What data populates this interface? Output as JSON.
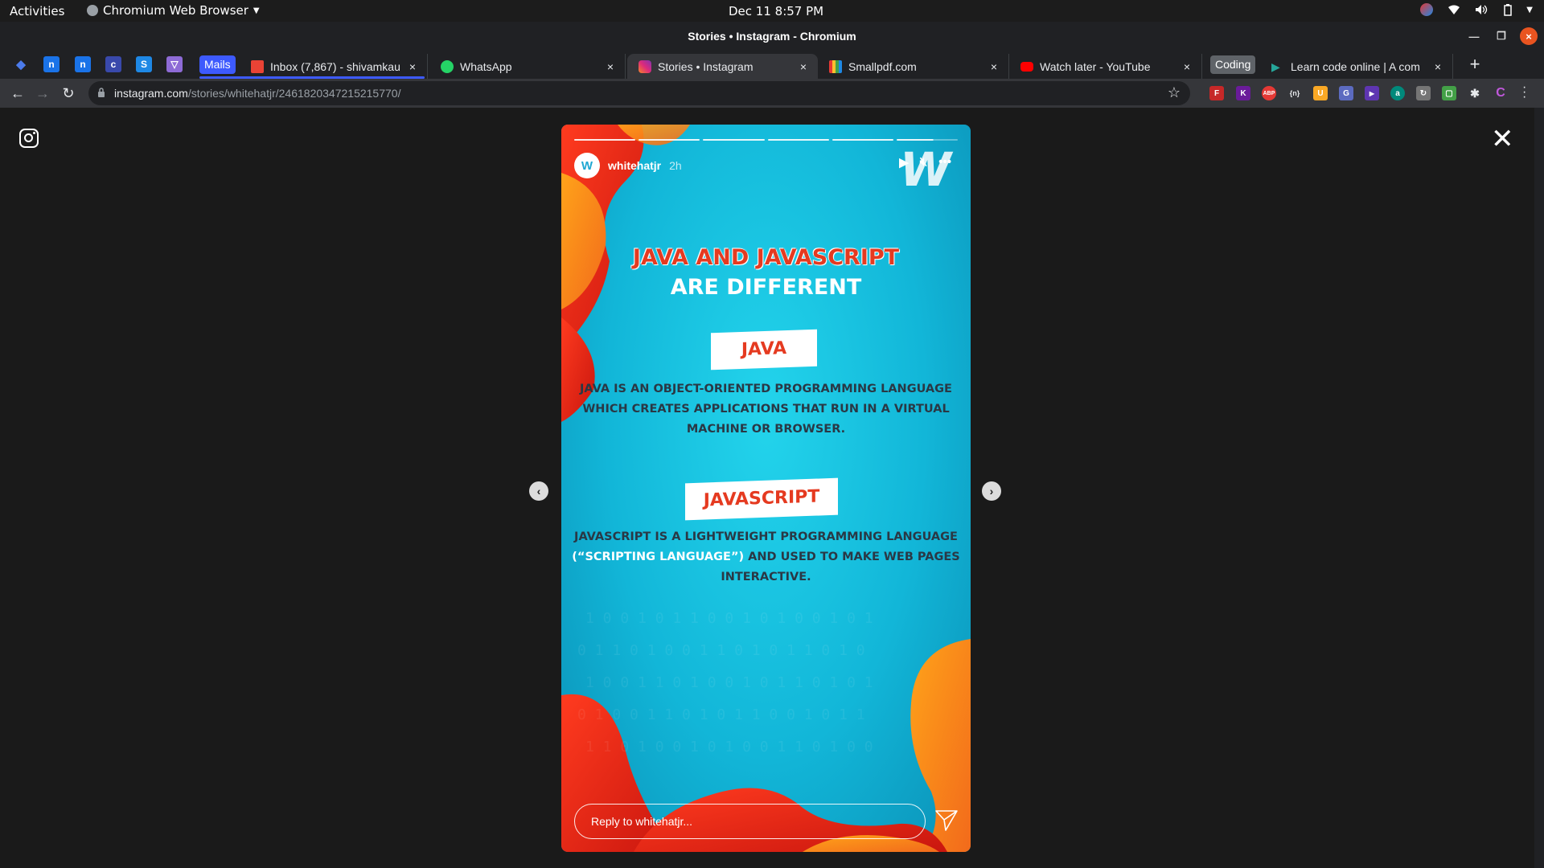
{
  "system_bar": {
    "activities": "Activities",
    "app_name": "Chromium Web Browser",
    "clock": "Dec 11   8:57 PM"
  },
  "window": {
    "title": "Stories • Instagram - Chromium"
  },
  "pinned_tabs": [
    {
      "glyph": "◆",
      "color": "#1a73e8",
      "bg": "transparent"
    },
    {
      "glyph": "n",
      "color": "#fff",
      "bg": "#1a73e8"
    },
    {
      "glyph": "n",
      "color": "#fff",
      "bg": "#1a73e8"
    },
    {
      "glyph": "c",
      "color": "#fff",
      "bg": "#3949ab"
    },
    {
      "glyph": "S",
      "color": "#fff",
      "bg": "#1e88e5"
    },
    {
      "glyph": "▽",
      "color": "#fff",
      "bg": "#8e6bd6"
    }
  ],
  "tab_groups": {
    "mails": {
      "label": "Mails",
      "color": "#3d5afe"
    },
    "coding": {
      "label": "Coding",
      "color": "#5f6368"
    }
  },
  "tabs": [
    {
      "label": "Inbox (7,867) - shivamkau",
      "favicon_color": "#ea4335"
    },
    {
      "label": "WhatsApp",
      "favicon_color": "#25d366"
    },
    {
      "label": "Stories • Instagram",
      "favicon_color": "#e1306c"
    },
    {
      "label": "Smallpdf.com",
      "favicon_color": "#e53935"
    },
    {
      "label": "Watch later - YouTube",
      "favicon_color": "#ff0000"
    },
    {
      "label": "Learn code online | A com",
      "favicon_color": "#26a69a"
    }
  ],
  "tab_close": "×",
  "address_bar": {
    "host": "instagram.com",
    "path": "/stories/whitehatjr/2461820347215215770/"
  },
  "extensions": [
    {
      "glyph": "F",
      "color": "#c62828"
    },
    {
      "glyph": "K",
      "color": "#6a1b9a"
    },
    {
      "glyph": "ABP",
      "color": "#e53935"
    },
    {
      "glyph": "{n}",
      "color": "#5f6368"
    },
    {
      "glyph": "U",
      "color": "#f9a825"
    },
    {
      "glyph": "G",
      "color": "#5c6bc0"
    },
    {
      "glyph": "▶",
      "color": "#5e35b1"
    },
    {
      "glyph": "a",
      "color": "#00897b"
    },
    {
      "glyph": "↻",
      "color": "#757575"
    },
    {
      "glyph": "▢",
      "color": "#43a047"
    },
    {
      "glyph": "✱",
      "color": "#5f6368"
    },
    {
      "glyph": "C",
      "color": "#8e24aa"
    }
  ],
  "story": {
    "username": "whitehatjr",
    "avatar_text": "W",
    "time_ago": "2h",
    "brand_mark": "W",
    "title_line1": "JAVA AND JAVASCRIPT",
    "title_line2": "ARE DIFFERENT",
    "label_java": "JAVA",
    "desc_java": "JAVA IS AN OBJECT-ORIENTED PROGRAMMING LANGUAGE WHICH  CREATES APPLICATIONS THAT RUN IN A VIRTUAL MACHINE OR BROWSER.",
    "label_js": "JAVASCRIPT",
    "desc_js_part1": "JAVASCRIPT IS A LIGHTWEIGHT PROGRAMMING LANGUAGE",
    "desc_js_highlight": "(“SCRIPTING LANGUAGE”)",
    "desc_js_part2": "AND USED TO MAKE WEB PAGES INTERACTIVE.",
    "reply_placeholder": "Reply to whitehatjr...",
    "segments": 6,
    "current_segment_progress": 0.6
  },
  "colors": {
    "story_red": "#e53a20",
    "story_orange": "#f7931e",
    "story_cyan": "#12b6d8"
  }
}
